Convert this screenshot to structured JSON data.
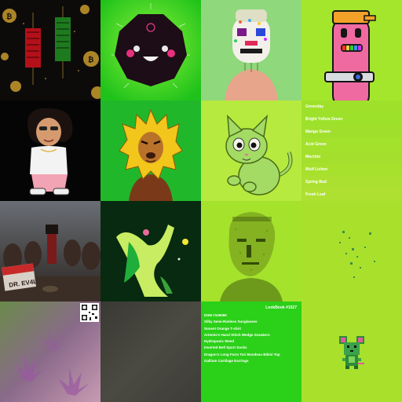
{
  "palette": {
    "colors": [
      {
        "name": "Greenday",
        "hex": "#9fe02a"
      },
      {
        "name": "Bright Yellow Green",
        "hex": "#9ee12b"
      },
      {
        "name": "Mango Green",
        "hex": "#a0e02d"
      },
      {
        "name": "Acid Green",
        "hex": "#a3e12c"
      },
      {
        "name": "Mochito",
        "hex": "#a5df2d"
      },
      {
        "name": "Wolf Lichen",
        "hex": "#a8e02e"
      },
      {
        "name": "Spring Bud",
        "hex": "#abe030"
      },
      {
        "name": "Fresh Leaf",
        "hex": "#aee031"
      }
    ]
  },
  "lookbook": {
    "title": "LookBook #1527",
    "items": [
      "DSM #106080",
      "Silky Semi-Rimless Sunglasses",
      "Sunset Orange T-shirt",
      "Artemis's Hand Stitch Wedge Sneakers",
      "Hydroponic Weed",
      "Inverted Bell Sport Socks",
      "Dragon's Long Form Tori Bondeau Bikini Top",
      "Gallium Cartilage Earrings"
    ]
  },
  "poster": {
    "label": "DR. EV4L"
  },
  "colors": {
    "bright_green": "#32e612",
    "lime": "#a6e22b",
    "dark": "#0b0b0b"
  }
}
